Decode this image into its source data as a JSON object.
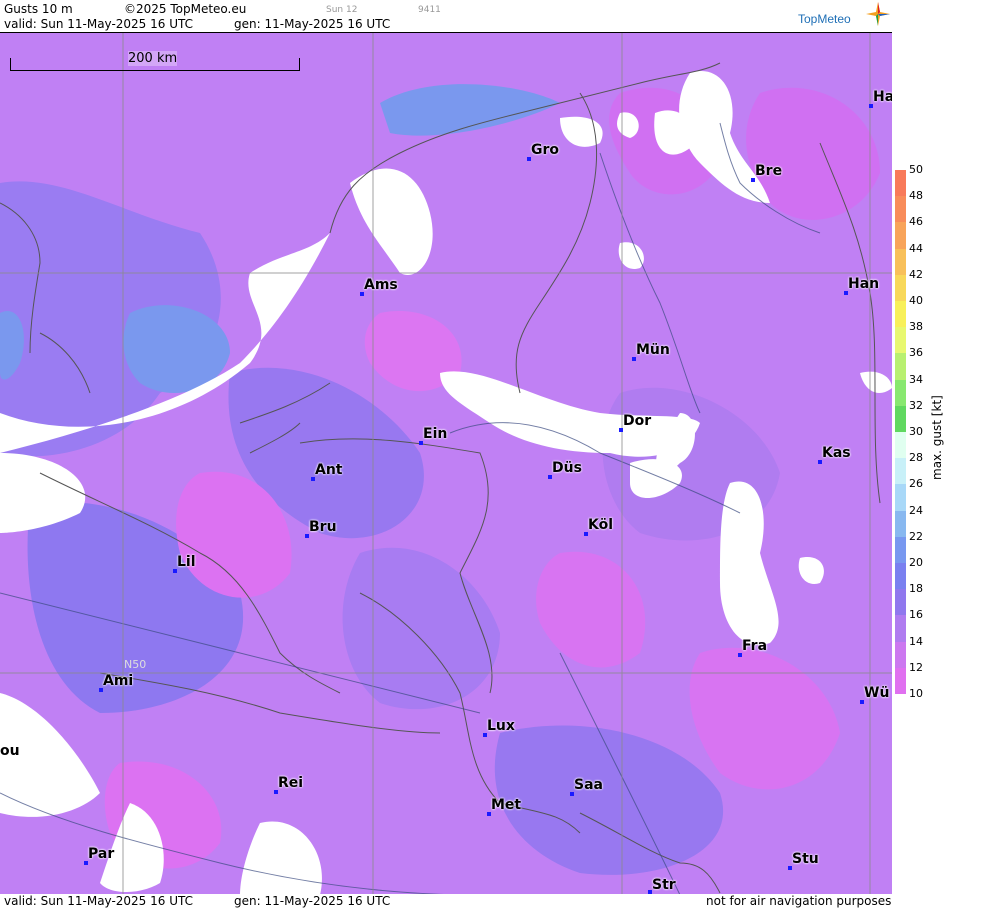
{
  "header": {
    "title": "Gusts 10 m",
    "copyright": "©2025 TopMeteo.eu",
    "day_code": "Sun 12",
    "code": "9411",
    "valid": "valid:  Sun  11-May-2025  16 UTC",
    "gen": "gen: 11-May-2025 16 UTC",
    "brand": "TopMeteo"
  },
  "footer": {
    "valid": "valid:  Sun  11-May-2025  16 UTC",
    "gen": "gen: 11-May-2025 16 UTC",
    "disclaimer": "not for air navigation purposes"
  },
  "map": {
    "scale_label": "200 km",
    "lat_label": "N50",
    "cities": [
      {
        "name": "Ha"
      },
      {
        "name": "Gro"
      },
      {
        "name": "Bre"
      },
      {
        "name": "Ams"
      },
      {
        "name": "Han"
      },
      {
        "name": "Mün"
      },
      {
        "name": "Ein"
      },
      {
        "name": "Dor"
      },
      {
        "name": "Kas"
      },
      {
        "name": "Ant"
      },
      {
        "name": "Düs"
      },
      {
        "name": "Bru"
      },
      {
        "name": "Köl"
      },
      {
        "name": "Lil"
      },
      {
        "name": "Fra"
      },
      {
        "name": "Ami"
      },
      {
        "name": "Wü"
      },
      {
        "name": "ou"
      },
      {
        "name": "Lux"
      },
      {
        "name": "Rei"
      },
      {
        "name": "Saa"
      },
      {
        "name": "Met"
      },
      {
        "name": "Par"
      },
      {
        "name": "Stu"
      },
      {
        "name": "Str"
      }
    ]
  },
  "legend": {
    "unit": "max. gust [kt]",
    "ticks": [
      "50",
      "48",
      "46",
      "44",
      "42",
      "40",
      "38",
      "36",
      "34",
      "32",
      "30",
      "28",
      "26",
      "24",
      "22",
      "20",
      "18",
      "16",
      "14",
      "12",
      "10"
    ],
    "colors": [
      "#f87a5a",
      "#f88c5a",
      "#f8a45a",
      "#f8c05a",
      "#f8d85a",
      "#f8f05a",
      "#e8f870",
      "#b8f070",
      "#88e870",
      "#60d860",
      "#e0fff0",
      "#c8f0f8",
      "#a8d8f8",
      "#88b8f0",
      "#7898f0",
      "#7a80f0",
      "#9078ee",
      "#b07cf0",
      "#cc78f0",
      "#e070f0"
    ]
  }
}
